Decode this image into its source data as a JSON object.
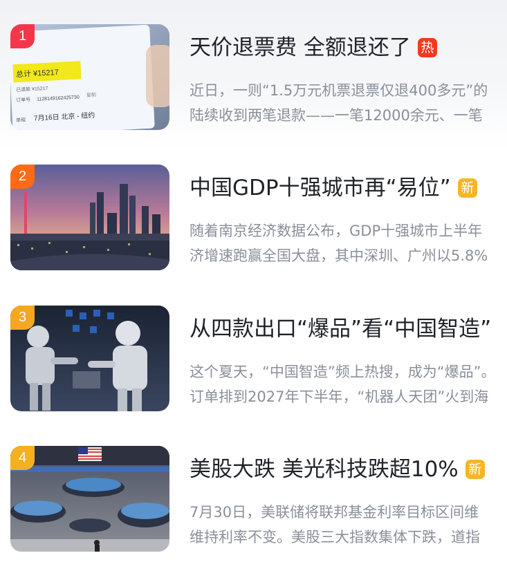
{
  "news": [
    {
      "rank": "1",
      "title": "天价退票费 全额退还了",
      "badge": "热",
      "summary_line1": "近日，一则“1.5万元机票退票仅退400多元”的",
      "summary_line2": "陆续收到两笔退款——一笔12000余元、一笔",
      "thumb_text": {
        "total": "总计 ¥15217",
        "paid": "已退款 ¥15217",
        "order": "订单号",
        "order_no": "1128149162425730",
        "copy": "复制",
        "trip_label": "单程",
        "trip": "7月16日 北京 - 纽约"
      }
    },
    {
      "rank": "2",
      "title": "中国GDP十强城市再“易位”",
      "badge": "新",
      "summary_line1": "随着南京经济数据公布，GDP十强城市上半年",
      "summary_line2": "济增速跑赢全国大盘，其中深圳、广州以5.8%"
    },
    {
      "rank": "3",
      "title": "从四款出口“爆品”看“中国智造”",
      "badge": "",
      "summary_line1": "这个夏天，“中国智造”频上热搜，成为“爆品”。",
      "summary_line2": "订单排到2027年下半年，“机器人天团”火到海"
    },
    {
      "rank": "4",
      "title": "美股大跌 美光科技跌超10%",
      "badge": "新",
      "summary_line1": "7月30日，美联储将联邦基金利率目标区间维",
      "summary_line2": "维持利率不变。美股三大指数集体下跌，道指"
    }
  ],
  "colors": {
    "rank1": "#f5364a",
    "rank2": "#ff6a14",
    "rank3": "#f5a623",
    "rank4": "#f5b021",
    "badge_hot": "#f5391f",
    "badge_new": "#f6b623"
  }
}
